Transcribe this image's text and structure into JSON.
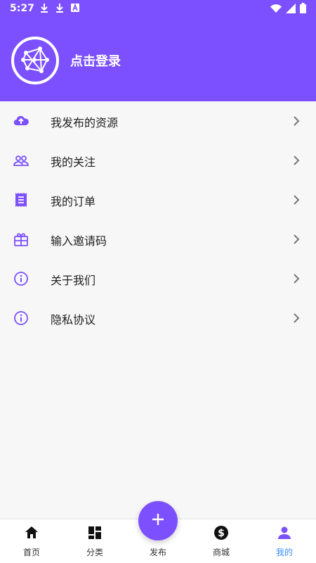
{
  "status_bar": {
    "time": "5:27",
    "left_icons": [
      "download-icon",
      "download-icon",
      "app-a-icon"
    ],
    "right_icons": [
      "wifi-icon",
      "signal-icon",
      "battery-icon"
    ]
  },
  "colors": {
    "primary": "#7c50ff",
    "active_nav": "#3a8cff",
    "background": "#f7f7f7"
  },
  "profile": {
    "login_text": "点击登录"
  },
  "menu": {
    "items": [
      {
        "label": "我发布的资源",
        "icon": "cloud-upload-icon"
      },
      {
        "label": "我的关注",
        "icon": "people-icon"
      },
      {
        "label": "我的订单",
        "icon": "receipt-icon"
      },
      {
        "label": "输入邀请码",
        "icon": "gift-icon"
      },
      {
        "label": "关于我们",
        "icon": "info-icon"
      },
      {
        "label": "隐私协议",
        "icon": "info-icon"
      }
    ]
  },
  "bottom_nav": {
    "items": [
      {
        "label": "首页",
        "icon": "home-icon"
      },
      {
        "label": "分类",
        "icon": "grid-icon"
      },
      {
        "label": "发布",
        "icon": "plus-icon"
      },
      {
        "label": "商城",
        "icon": "dollar-icon"
      },
      {
        "label": "我的",
        "icon": "person-icon",
        "active": true
      }
    ]
  }
}
